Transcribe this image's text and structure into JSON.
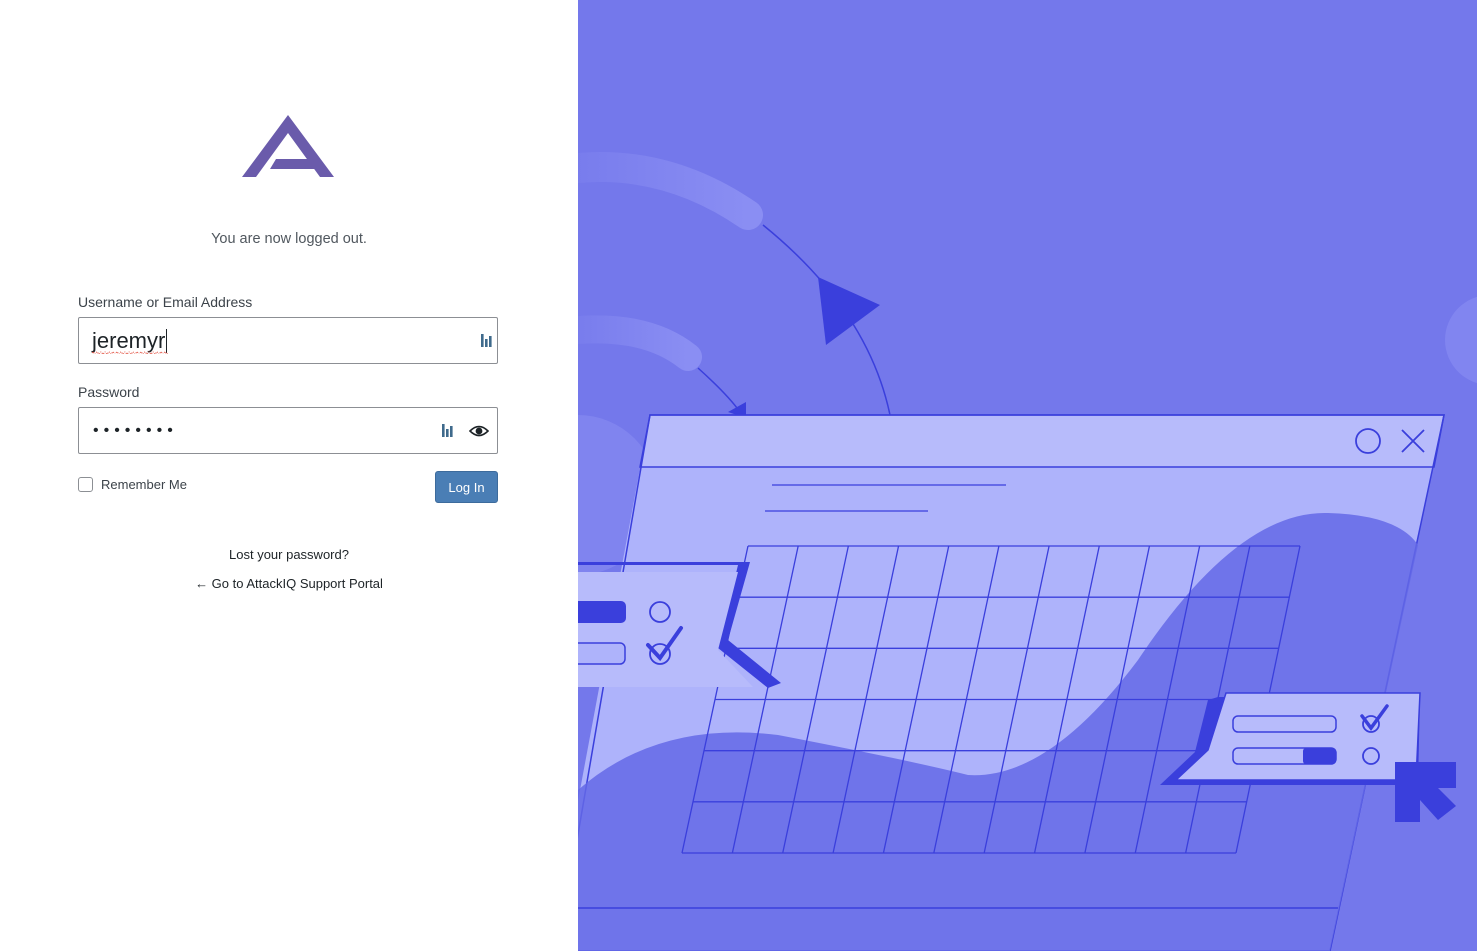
{
  "logo": {
    "name": "attackiq-logo-icon",
    "color": "#6a5bab"
  },
  "message": "You are now logged out.",
  "form": {
    "username_label": "Username or Email Address",
    "username_value": "jeremyr",
    "password_label": "Password",
    "password_masked": "••••••••",
    "remember_label": "Remember Me",
    "remember_checked": false,
    "submit_label": "Log In"
  },
  "links": {
    "lost_password": "Lost your password?",
    "back_to_portal": "← Go to AttackIQ Support Portal"
  },
  "icons": {
    "password_manager": "password-manager-icon",
    "show_password": "eye-icon"
  },
  "colors": {
    "accent_button": "#4a7eb5",
    "illustration_background": "#7478eb",
    "illustration_dark": "#3a3fdc",
    "illustration_light": "#aeb3fb"
  }
}
